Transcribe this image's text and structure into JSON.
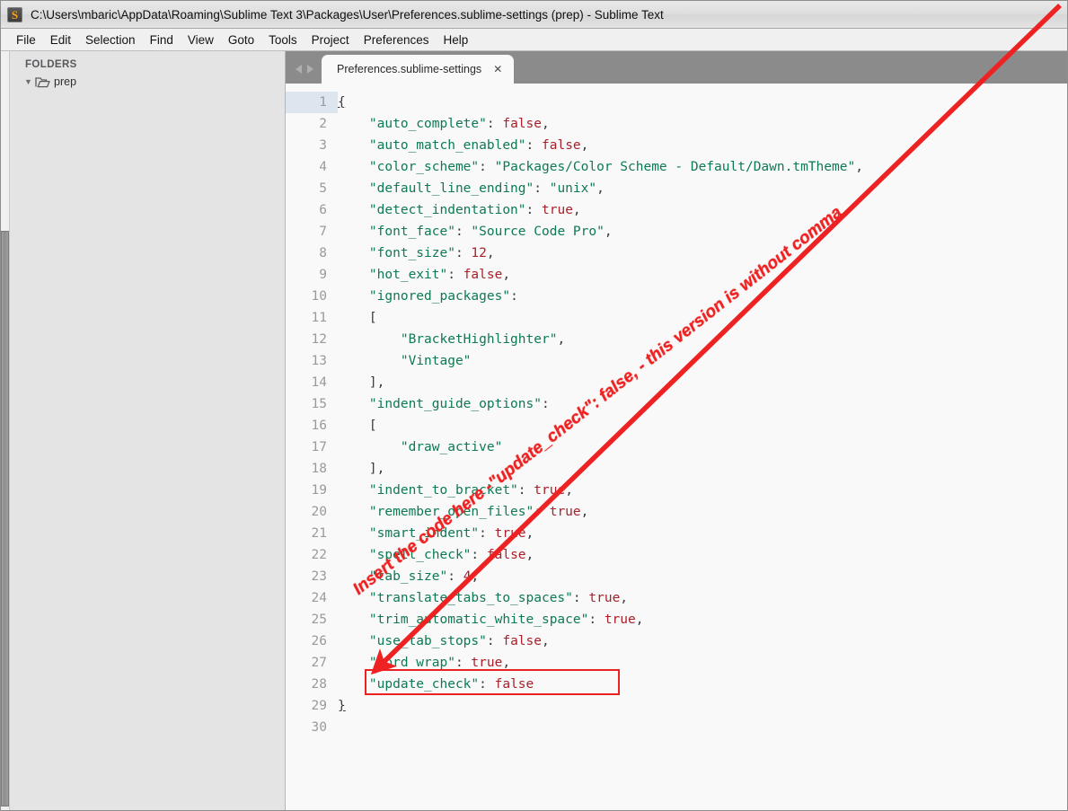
{
  "window": {
    "title": "C:\\Users\\mbaric\\AppData\\Roaming\\Sublime Text 3\\Packages\\User\\Preferences.sublime-settings (prep) - Sublime Text",
    "app_icon_glyph": "S"
  },
  "menu": {
    "items": [
      {
        "label": "File"
      },
      {
        "label": "Edit"
      },
      {
        "label": "Selection"
      },
      {
        "label": "Find"
      },
      {
        "label": "View"
      },
      {
        "label": "Goto"
      },
      {
        "label": "Tools"
      },
      {
        "label": "Project"
      },
      {
        "label": "Preferences"
      },
      {
        "label": "Help"
      }
    ]
  },
  "sidebar": {
    "header": "FOLDERS",
    "disclosure_glyph": "▼",
    "folders": [
      {
        "label": "prep"
      }
    ]
  },
  "tab_bar": {
    "nav_back_icon": "arrow-left-icon",
    "nav_forward_icon": "arrow-right-icon",
    "tabs": [
      {
        "label": "Preferences.sublime-settings",
        "close_glyph": "✕",
        "active": true
      }
    ]
  },
  "editor": {
    "active_line": 1,
    "line_numbers": [
      1,
      2,
      3,
      4,
      5,
      6,
      7,
      8,
      9,
      10,
      11,
      12,
      13,
      14,
      15,
      16,
      17,
      18,
      19,
      20,
      21,
      22,
      23,
      24,
      25,
      26,
      27,
      28,
      29,
      30
    ],
    "lines": [
      {
        "n": 1,
        "indent": 0,
        "tokens": [
          {
            "t": "brace",
            "v": "{"
          }
        ]
      },
      {
        "n": 2,
        "indent": 1,
        "tokens": [
          {
            "t": "key",
            "v": "\"auto_complete\""
          },
          {
            "t": "punct",
            "v": ": "
          },
          {
            "t": "val",
            "v": "false"
          },
          {
            "t": "punct",
            "v": ","
          }
        ]
      },
      {
        "n": 3,
        "indent": 1,
        "tokens": [
          {
            "t": "key",
            "v": "\"auto_match_enabled\""
          },
          {
            "t": "punct",
            "v": ": "
          },
          {
            "t": "val",
            "v": "false"
          },
          {
            "t": "punct",
            "v": ","
          }
        ]
      },
      {
        "n": 4,
        "indent": 1,
        "tokens": [
          {
            "t": "key",
            "v": "\"color_scheme\""
          },
          {
            "t": "punct",
            "v": ": "
          },
          {
            "t": "str",
            "v": "\"Packages/Color Scheme - Default/Dawn.tmTheme\""
          },
          {
            "t": "punct",
            "v": ","
          }
        ]
      },
      {
        "n": 5,
        "indent": 1,
        "tokens": [
          {
            "t": "key",
            "v": "\"default_line_ending\""
          },
          {
            "t": "punct",
            "v": ": "
          },
          {
            "t": "str",
            "v": "\"unix\""
          },
          {
            "t": "punct",
            "v": ","
          }
        ]
      },
      {
        "n": 6,
        "indent": 1,
        "tokens": [
          {
            "t": "key",
            "v": "\"detect_indentation\""
          },
          {
            "t": "punct",
            "v": ": "
          },
          {
            "t": "val",
            "v": "true"
          },
          {
            "t": "punct",
            "v": ","
          }
        ]
      },
      {
        "n": 7,
        "indent": 1,
        "tokens": [
          {
            "t": "key",
            "v": "\"font_face\""
          },
          {
            "t": "punct",
            "v": ": "
          },
          {
            "t": "str",
            "v": "\"Source Code Pro\""
          },
          {
            "t": "punct",
            "v": ","
          }
        ]
      },
      {
        "n": 8,
        "indent": 1,
        "tokens": [
          {
            "t": "key",
            "v": "\"font_size\""
          },
          {
            "t": "punct",
            "v": ": "
          },
          {
            "t": "val",
            "v": "12"
          },
          {
            "t": "punct",
            "v": ","
          }
        ]
      },
      {
        "n": 9,
        "indent": 1,
        "tokens": [
          {
            "t": "key",
            "v": "\"hot_exit\""
          },
          {
            "t": "punct",
            "v": ": "
          },
          {
            "t": "val",
            "v": "false"
          },
          {
            "t": "punct",
            "v": ","
          }
        ]
      },
      {
        "n": 10,
        "indent": 1,
        "tokens": [
          {
            "t": "key",
            "v": "\"ignored_packages\""
          },
          {
            "t": "punct",
            "v": ":"
          }
        ]
      },
      {
        "n": 11,
        "indent": 1,
        "tokens": [
          {
            "t": "punct",
            "v": "["
          }
        ]
      },
      {
        "n": 12,
        "indent": 2,
        "tokens": [
          {
            "t": "str",
            "v": "\"BracketHighlighter\""
          },
          {
            "t": "punct",
            "v": ","
          }
        ]
      },
      {
        "n": 13,
        "indent": 2,
        "tokens": [
          {
            "t": "str",
            "v": "\"Vintage\""
          }
        ]
      },
      {
        "n": 14,
        "indent": 1,
        "tokens": [
          {
            "t": "punct",
            "v": "],"
          }
        ]
      },
      {
        "n": 15,
        "indent": 1,
        "tokens": [
          {
            "t": "key",
            "v": "\"indent_guide_options\""
          },
          {
            "t": "punct",
            "v": ":"
          }
        ]
      },
      {
        "n": 16,
        "indent": 1,
        "tokens": [
          {
            "t": "punct",
            "v": "["
          }
        ]
      },
      {
        "n": 17,
        "indent": 2,
        "tokens": [
          {
            "t": "str",
            "v": "\"draw_active\""
          }
        ]
      },
      {
        "n": 18,
        "indent": 1,
        "tokens": [
          {
            "t": "punct",
            "v": "],"
          }
        ]
      },
      {
        "n": 19,
        "indent": 1,
        "tokens": [
          {
            "t": "key",
            "v": "\"indent_to_bracket\""
          },
          {
            "t": "punct",
            "v": ": "
          },
          {
            "t": "val",
            "v": "true"
          },
          {
            "t": "punct",
            "v": ","
          }
        ]
      },
      {
        "n": 20,
        "indent": 1,
        "tokens": [
          {
            "t": "key",
            "v": "\"remember_open_files\""
          },
          {
            "t": "punct",
            "v": ": "
          },
          {
            "t": "val",
            "v": "true"
          },
          {
            "t": "punct",
            "v": ","
          }
        ]
      },
      {
        "n": 21,
        "indent": 1,
        "tokens": [
          {
            "t": "key",
            "v": "\"smart_indent\""
          },
          {
            "t": "punct",
            "v": ": "
          },
          {
            "t": "val",
            "v": "true"
          },
          {
            "t": "punct",
            "v": ","
          }
        ]
      },
      {
        "n": 22,
        "indent": 1,
        "tokens": [
          {
            "t": "key",
            "v": "\"spell_check\""
          },
          {
            "t": "punct",
            "v": ": "
          },
          {
            "t": "val",
            "v": "false"
          },
          {
            "t": "punct",
            "v": ","
          }
        ]
      },
      {
        "n": 23,
        "indent": 1,
        "tokens": [
          {
            "t": "key",
            "v": "\"tab_size\""
          },
          {
            "t": "punct",
            "v": ": "
          },
          {
            "t": "val",
            "v": "4"
          },
          {
            "t": "punct",
            "v": ","
          }
        ]
      },
      {
        "n": 24,
        "indent": 1,
        "tokens": [
          {
            "t": "key",
            "v": "\"translate_tabs_to_spaces\""
          },
          {
            "t": "punct",
            "v": ": "
          },
          {
            "t": "val",
            "v": "true"
          },
          {
            "t": "punct",
            "v": ","
          }
        ]
      },
      {
        "n": 25,
        "indent": 1,
        "tokens": [
          {
            "t": "key",
            "v": "\"trim_automatic_white_space\""
          },
          {
            "t": "punct",
            "v": ": "
          },
          {
            "t": "val",
            "v": "true"
          },
          {
            "t": "punct",
            "v": ","
          }
        ]
      },
      {
        "n": 26,
        "indent": 1,
        "tokens": [
          {
            "t": "key",
            "v": "\"use_tab_stops\""
          },
          {
            "t": "punct",
            "v": ": "
          },
          {
            "t": "val",
            "v": "false"
          },
          {
            "t": "punct",
            "v": ","
          }
        ]
      },
      {
        "n": 27,
        "indent": 1,
        "tokens": [
          {
            "t": "key",
            "v": "\"word_wrap\""
          },
          {
            "t": "punct",
            "v": ": "
          },
          {
            "t": "val",
            "v": "true"
          },
          {
            "t": "punct",
            "v": ","
          }
        ]
      },
      {
        "n": 28,
        "indent": 1,
        "tokens": [
          {
            "t": "key",
            "v": "\"update_check\""
          },
          {
            "t": "punct",
            "v": ": "
          },
          {
            "t": "val",
            "v": "false"
          }
        ]
      },
      {
        "n": 29,
        "indent": 0,
        "tokens": [
          {
            "t": "brace",
            "v": "}"
          }
        ]
      },
      {
        "n": 30,
        "indent": 0,
        "tokens": []
      }
    ]
  },
  "annotations": {
    "callout_text": "Insert the code here -\"update_check\": false, - this version is without comma",
    "callout_color": "#ee2222",
    "highlight_box_color": "#ec2222",
    "highlight_target_line": 28
  }
}
